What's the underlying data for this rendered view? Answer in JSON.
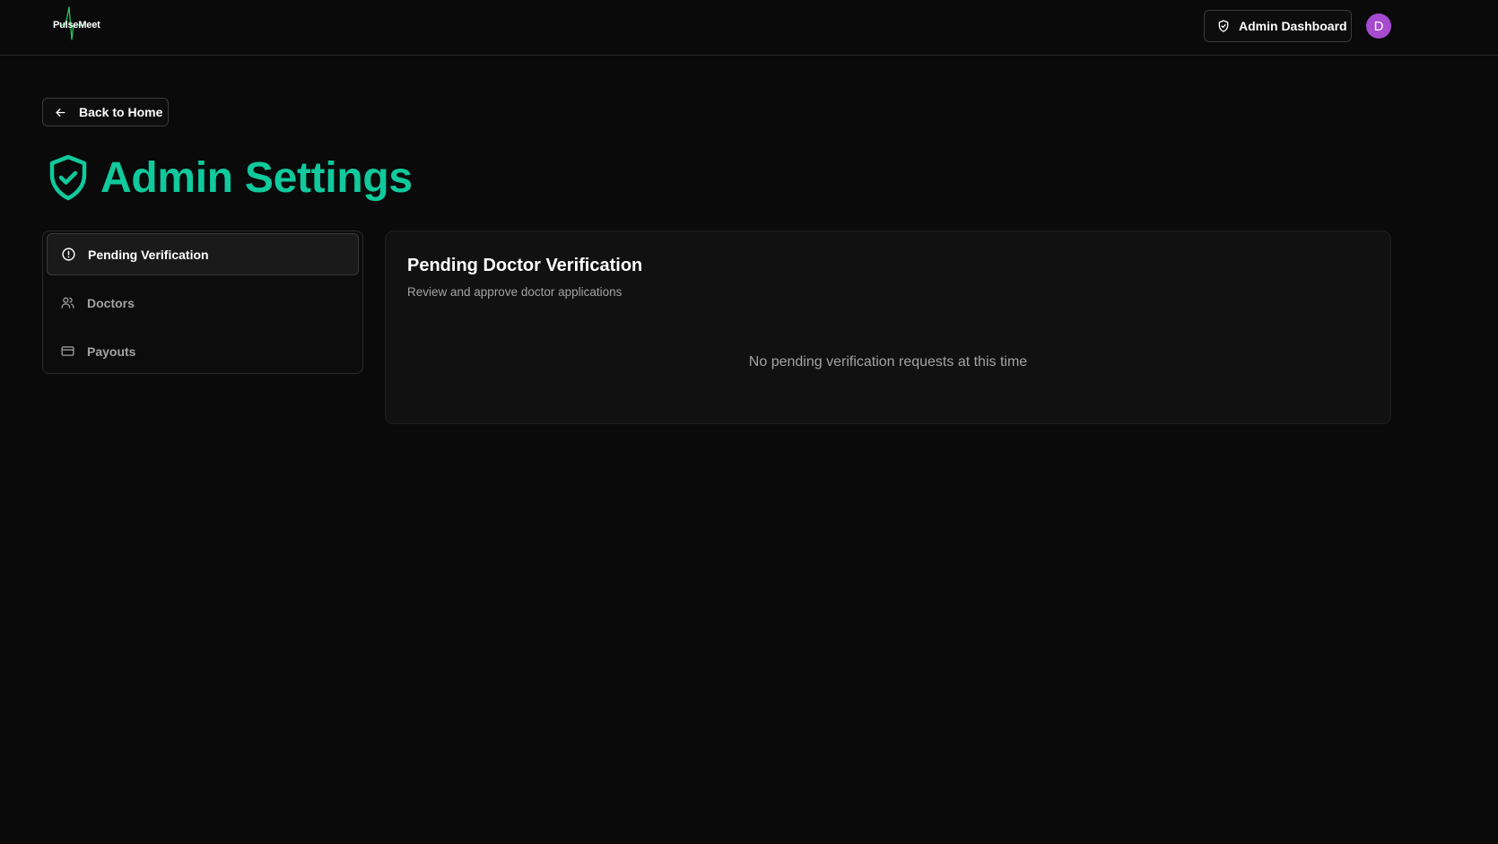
{
  "header": {
    "logo_text": "PulseMeet",
    "admin_dashboard_label": "Admin Dashboard",
    "avatar_initial": "D",
    "accent_color": "#22c55e",
    "avatar_color": "#a64ad0"
  },
  "back_button": {
    "label": "Back to Home",
    "icon": "arrow-left-icon"
  },
  "page": {
    "title": "Admin Settings",
    "title_icon": "shield-check-icon",
    "title_color": "#10c99c"
  },
  "sidebar": {
    "items": [
      {
        "label": "Pending Verification",
        "icon": "alert-circle-icon",
        "active": true
      },
      {
        "label": "Doctors",
        "icon": "users-icon",
        "active": false
      },
      {
        "label": "Payouts",
        "icon": "credit-card-icon",
        "active": false
      }
    ]
  },
  "panel": {
    "title": "Pending Doctor Verification",
    "subtitle": "Review and approve doctor applications",
    "empty_message": "No pending verification requests at this time"
  }
}
